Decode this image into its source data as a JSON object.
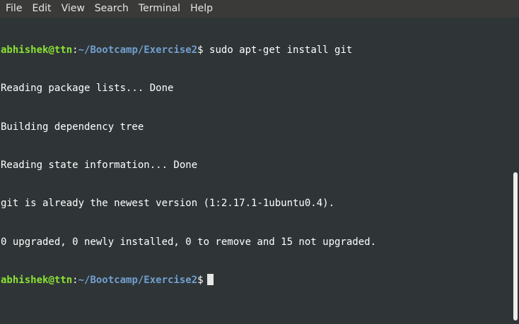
{
  "menu": {
    "items": [
      "File",
      "Edit",
      "View",
      "Search",
      "Terminal",
      "Help"
    ]
  },
  "terminal": {
    "prompt": {
      "user_host": "abhishek@ttn",
      "colon": ":",
      "path": "~/Bootcamp/Exercise2",
      "dollar": "$"
    },
    "command": " sudo apt-get install git",
    "output": [
      "Reading package lists... Done",
      "Building dependency tree",
      "Reading state information... Done",
      "git is already the newest version (1:2.17.1-1ubuntu0.4).",
      "0 upgraded, 0 newly installed, 0 to remove and 15 not upgraded."
    ]
  },
  "colors": {
    "background": "#2f3537",
    "menubar": "#3a3a38",
    "prompt_user": "#8ae234",
    "prompt_path": "#729fcf",
    "text": "#ffffff"
  }
}
